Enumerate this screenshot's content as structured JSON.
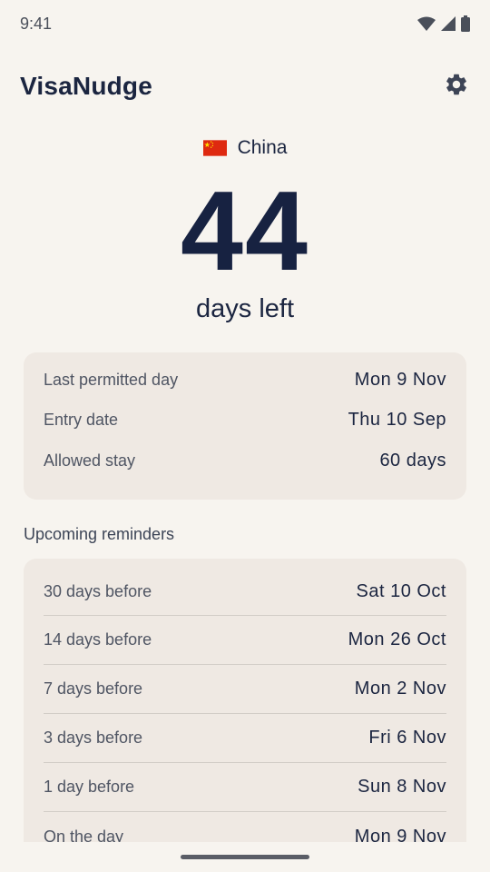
{
  "status_bar": {
    "time": "9:41",
    "icons": [
      "wifi-icon",
      "signal-icon",
      "battery-icon"
    ]
  },
  "app_bar": {
    "title": "VisaNudge",
    "settings_icon": "gear-icon"
  },
  "hero": {
    "flag": "china-flag-icon",
    "country": "China",
    "days_left": "44",
    "days_label": "days left"
  },
  "summary": {
    "rows": [
      {
        "label": "Last permitted day",
        "value": "Mon 9 Nov"
      },
      {
        "label": "Entry date",
        "value": "Thu 10 Sep"
      },
      {
        "label": "Allowed stay",
        "value": "60 days"
      }
    ]
  },
  "reminders": {
    "title": "Upcoming reminders",
    "rows": [
      {
        "label": "30 days before",
        "value": "Sat 10 Oct"
      },
      {
        "label": "14 days before",
        "value": "Mon 26 Oct"
      },
      {
        "label": "7 days before",
        "value": "Mon 2 Nov"
      },
      {
        "label": "3 days before",
        "value": "Fri 6 Nov"
      },
      {
        "label": "1 day before",
        "value": "Sun 8 Nov"
      },
      {
        "label": "On the day",
        "value": "Mon 9 Nov"
      }
    ]
  },
  "colors": {
    "background": "#f7f4ef",
    "card": "#efe9e3",
    "text_primary": "#1b2540",
    "text_secondary": "#4f5563",
    "flag_red": "#de2910",
    "flag_yellow": "#ffde00"
  }
}
